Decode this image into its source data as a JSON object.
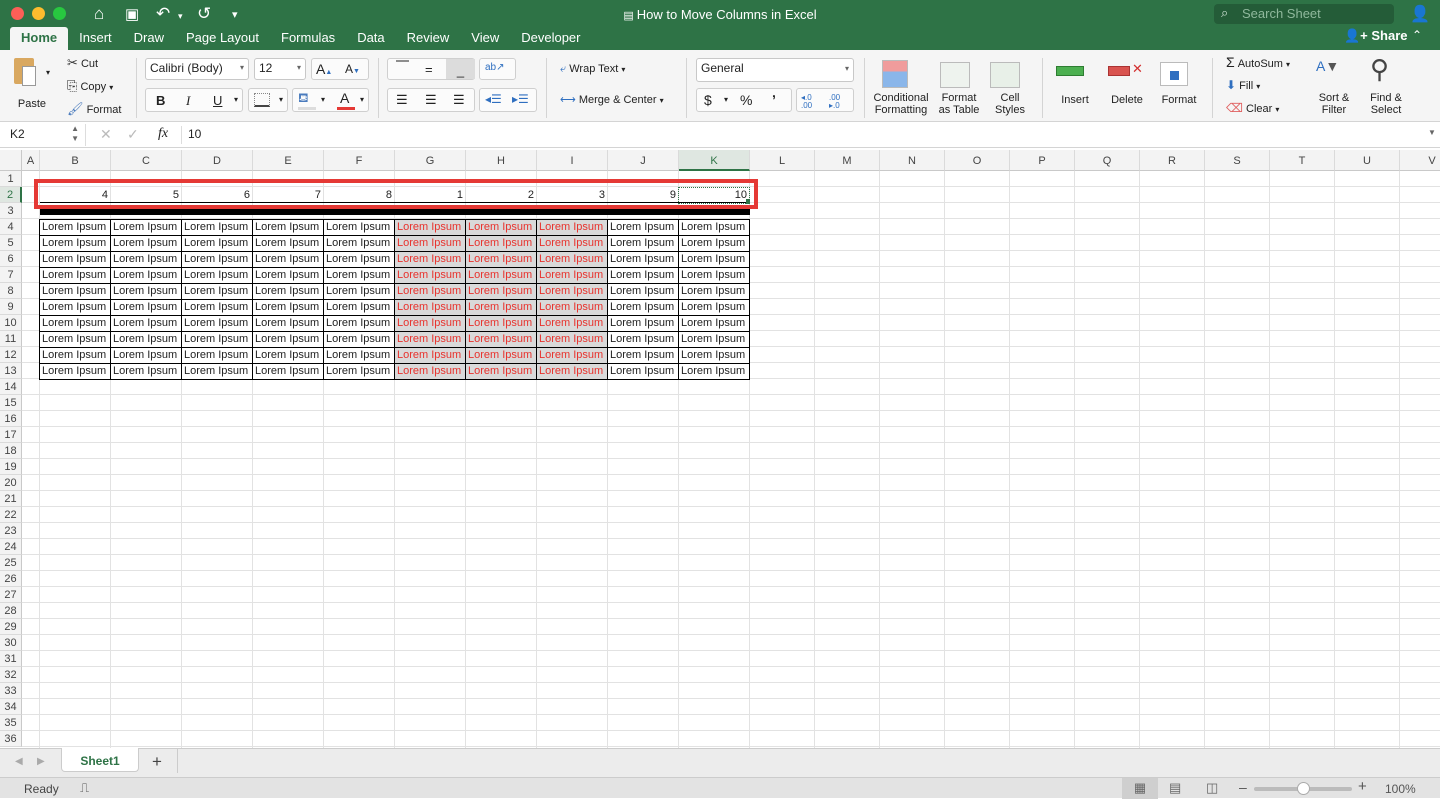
{
  "window": {
    "title": "How to Move Columns in Excel",
    "search_placeholder": "Search Sheet",
    "share_label": "Share"
  },
  "tabs": [
    "Home",
    "Insert",
    "Draw",
    "Page Layout",
    "Formulas",
    "Data",
    "Review",
    "View",
    "Developer"
  ],
  "active_tab": "Home",
  "ribbon": {
    "clipboard": {
      "paste": "Paste",
      "cut": "Cut",
      "copy": "Copy",
      "format": "Format"
    },
    "font": {
      "name": "Calibri (Body)",
      "size": "12",
      "bold": "B",
      "italic": "I",
      "underline": "U"
    },
    "alignment": {
      "wrap_text": "Wrap Text",
      "merge_center": "Merge & Center"
    },
    "number": {
      "format": "General",
      "currency": "$",
      "percent": "%",
      "comma": "ʼ",
      "inc_decimal": "←.0 .00",
      "dec_decimal": ".00 →.0"
    },
    "styles": {
      "conditional": [
        "Conditional",
        "Formatting"
      ],
      "format_table": [
        "Format",
        "as Table"
      ],
      "cell_styles": [
        "Cell",
        "Styles"
      ]
    },
    "cells": {
      "insert": "Insert",
      "delete": "Delete",
      "format": "Format"
    },
    "editing": {
      "autosum": "AutoSum",
      "fill": "Fill",
      "clear": "Clear",
      "sort": [
        "Sort &",
        "Filter"
      ],
      "find": [
        "Find &",
        "Select"
      ]
    }
  },
  "formula_bar": {
    "name_box": "K2",
    "fx": "fx",
    "value": "10"
  },
  "columns": [
    "A",
    "B",
    "C",
    "D",
    "E",
    "F",
    "G",
    "H",
    "I",
    "J",
    "K",
    "L",
    "M",
    "N",
    "O",
    "P",
    "Q",
    "R",
    "S",
    "T",
    "U",
    "V"
  ],
  "selected_column": "K",
  "selected_row": "2",
  "rows": [
    "1",
    "2",
    "3",
    "4",
    "5",
    "6",
    "7",
    "8",
    "9",
    "10",
    "11",
    "12",
    "13",
    "14",
    "15",
    "16",
    "17",
    "18",
    "19",
    "20",
    "21",
    "22",
    "23",
    "24",
    "25",
    "26",
    "27",
    "28",
    "29",
    "30",
    "31",
    "32",
    "33",
    "34",
    "35",
    "36"
  ],
  "row2_values": [
    "4",
    "5",
    "6",
    "7",
    "8",
    "1",
    "2",
    "3",
    "9",
    "10"
  ],
  "table_text": "Lorem Ipsum",
  "table_rows": 10,
  "highlighted_columns": [
    "G",
    "H",
    "I"
  ],
  "colors": {
    "brand_green": "#2e7346",
    "highlight_red": "#e8322d",
    "highlight_fill": "#d9d9d9",
    "annotation_box": "#e53935"
  },
  "sheets": [
    {
      "name": "Sheet1",
      "active": true
    }
  ],
  "add_sheet": "+",
  "status": {
    "text": "Ready",
    "zoom": "100%",
    "zoom_level": 0.5
  }
}
